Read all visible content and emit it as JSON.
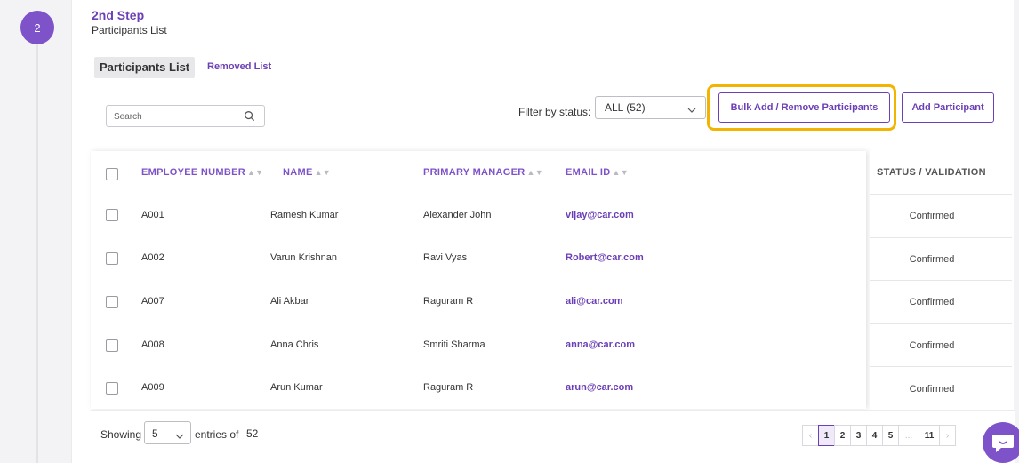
{
  "stepper": {
    "number": "2",
    "title": "2nd Step",
    "subtitle": "Participants List"
  },
  "tabs": {
    "active": "Participants List",
    "removed": "Removed List"
  },
  "search": {
    "placeholder": "Search"
  },
  "filter": {
    "label": "Filter by status:",
    "value": "ALL (52)"
  },
  "actions": {
    "bulk": "Bulk Add / Remove Participants",
    "add": "Add Participant"
  },
  "table": {
    "headers": {
      "employee_number": "EMPLOYEE NUMBER",
      "name": "NAME",
      "primary_manager": "PRIMARY MANAGER",
      "email": "EMAIL ID",
      "status": "STATUS / VALIDATION"
    },
    "rows": [
      {
        "emp": "A001",
        "name": "Ramesh Kumar",
        "manager": "Alexander John",
        "email": "vijay@car.com",
        "status": "Confirmed"
      },
      {
        "emp": "A002",
        "name": "Varun Krishnan",
        "manager": "Ravi Vyas",
        "email": "Robert@car.com",
        "status": "Confirmed"
      },
      {
        "emp": "A007",
        "name": "Ali Akbar",
        "manager": "Raguram R",
        "email": "ali@car.com",
        "status": "Confirmed"
      },
      {
        "emp": "A008",
        "name": "Anna Chris",
        "manager": "Smriti Sharma",
        "email": "anna@car.com",
        "status": "Confirmed"
      },
      {
        "emp": "A009",
        "name": "Arun Kumar",
        "manager": "Raguram R",
        "email": "arun@car.com",
        "status": "Confirmed"
      }
    ]
  },
  "footer": {
    "showing": "Showing",
    "per_page": "5",
    "entries_of": "entries of",
    "total": "52",
    "pages": [
      "1",
      "2",
      "3",
      "4",
      "5",
      "...",
      "11"
    ],
    "current_page": "1"
  },
  "colors": {
    "accent": "#6b3fb5",
    "highlight": "#f2b400"
  }
}
